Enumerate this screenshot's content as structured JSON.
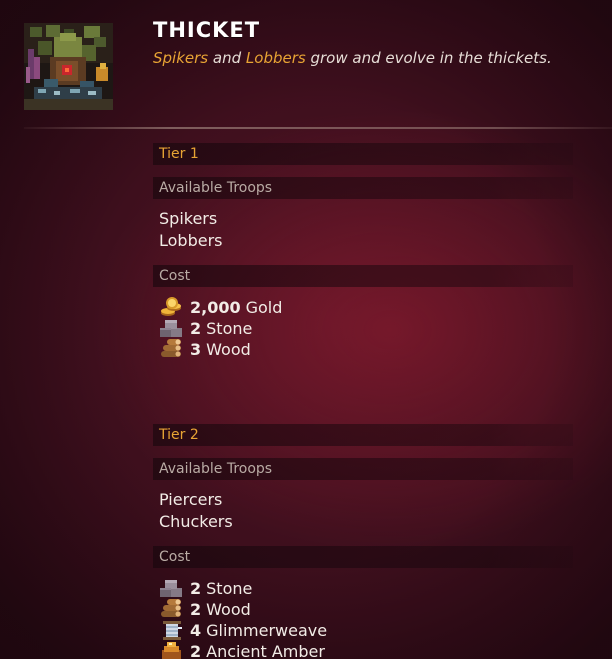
{
  "header": {
    "title": "THICKET",
    "subtitle_hl1": "Spikers",
    "subtitle_and": "and",
    "subtitle_hl2": "Lobbers",
    "subtitle_rest": "grow and evolve in the thickets.",
    "thumbnail_icon": "thicket-structure-art"
  },
  "colors": {
    "accent_gold": "#e8a434",
    "background": "#3e0f1d"
  },
  "tier1": {
    "heading": "Tier 1",
    "troops_label": "Available Troops",
    "troops": [
      "Spikers",
      "Lobbers"
    ],
    "cost_label": "Cost",
    "costs": [
      {
        "icon": "gold-coins-icon",
        "amount": "2,000",
        "resource": "Gold"
      },
      {
        "icon": "stone-blocks-icon",
        "amount": "2",
        "resource": "Stone"
      },
      {
        "icon": "wood-logs-icon",
        "amount": "3",
        "resource": "Wood"
      }
    ]
  },
  "tier2": {
    "heading": "Tier 2",
    "troops_label": "Available Troops",
    "troops": [
      "Piercers",
      "Chuckers"
    ],
    "cost_label": "Cost",
    "costs": [
      {
        "icon": "stone-blocks-icon",
        "amount": "2",
        "resource": "Stone"
      },
      {
        "icon": "wood-logs-icon",
        "amount": "2",
        "resource": "Wood"
      },
      {
        "icon": "glimmerweave-spool-icon",
        "amount": "4",
        "resource": "Glimmerweave"
      },
      {
        "icon": "ancient-amber-icon",
        "amount": "2",
        "resource": "Ancient Amber"
      }
    ]
  }
}
